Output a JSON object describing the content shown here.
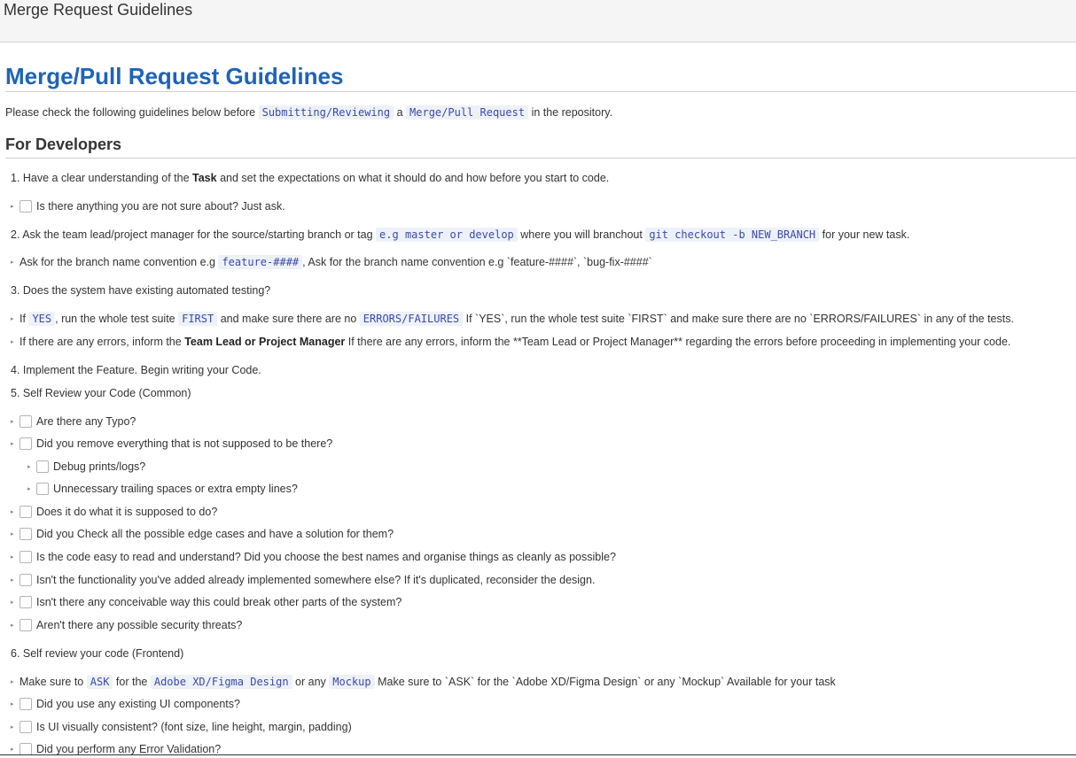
{
  "window": {
    "title": "Merge Request Guidelines"
  },
  "doc": {
    "title": "Merge/Pull Request Guidelines",
    "intro": {
      "pre": "Please check the following guidelines below before",
      "code1": "Submitting/Reviewing",
      "mid": "a",
      "code2": "Merge/Pull Request",
      "post": "in the repository."
    },
    "section": "For Developers",
    "step1": {
      "pre": "1. Have a clear understanding of the",
      "bold": "Task",
      "post": "and set the expectations on what it should do and how before you start to code."
    },
    "step1_check": "Is there anything you are not sure about? Just ask.",
    "step2": {
      "pre": "2. Ask the team lead/project manager for the source/starting branch or tag",
      "code1": "e.g master or develop",
      "mid": "where you will branchout",
      "code2": "git checkout -b NEW_BRANCH",
      "post": "for your new task."
    },
    "step2_item": {
      "pre": "Ask for the branch name convention e.g",
      "code": "feature-####",
      "post": ", Ask for the branch name convention e.g `feature-####`, `bug-fix-####`"
    },
    "step3": "3. Does the system have existing automated testing?",
    "step3_item1": {
      "a": "If",
      "code1": "YES",
      "b": ", run the whole test suite",
      "code2": "FIRST",
      "c": "and make sure there are no",
      "code3": "ERRORS/FAILURES",
      "d": "If `YES`, run the whole test suite `FIRST` and make sure there are no `ERRORS/FAILURES` in any of the tests."
    },
    "step3_item2": {
      "a": "If there are any errors, inform the",
      "bold": "Team Lead or Project Manager",
      "b": "If there are any errors, inform the **Team Lead or Project Manager** regarding the errors before proceeding in implementing your code."
    },
    "step4": "4. Implement the Feature. Begin writing your Code.",
    "step5": "5. Self Review your Code (Common)",
    "step5_checks": [
      "Are there any Typo?",
      "Did you remove everything that is not supposed to be there?",
      "Debug prints/logs?",
      "Unnecessary trailing spaces or extra empty lines?",
      "Does it do what it is supposed to do?",
      "Did you Check all the possible edge cases and have a solution for them?",
      "Is the code easy to read and understand? Did you choose the best names and organise things as cleanly as possible?",
      "Isn't the functionality you've added already implemented somewhere else? If it's duplicated, reconsider the design.",
      "Isn't there any conceivable way this could break other parts of the system?",
      "Aren't there any possible security threats?"
    ],
    "step6": "6. Self review your code (Frontend)",
    "step6_item": {
      "a": "Make sure to",
      "code1": "ASK",
      "b": "for the",
      "code2": "Adobe XD/Figma Design",
      "c": "or any",
      "code3": "Mockup",
      "d": "Make sure to `ASK` for the `Adobe XD/Figma Design` or any `Mockup` Available for your task"
    },
    "step6_checks": [
      "Did you use any existing UI components?",
      "Is UI visually consistent? (font size, line height, margin, padding)",
      "Did you perform any Error Validation?"
    ],
    "bullet_glyph": "▸"
  }
}
